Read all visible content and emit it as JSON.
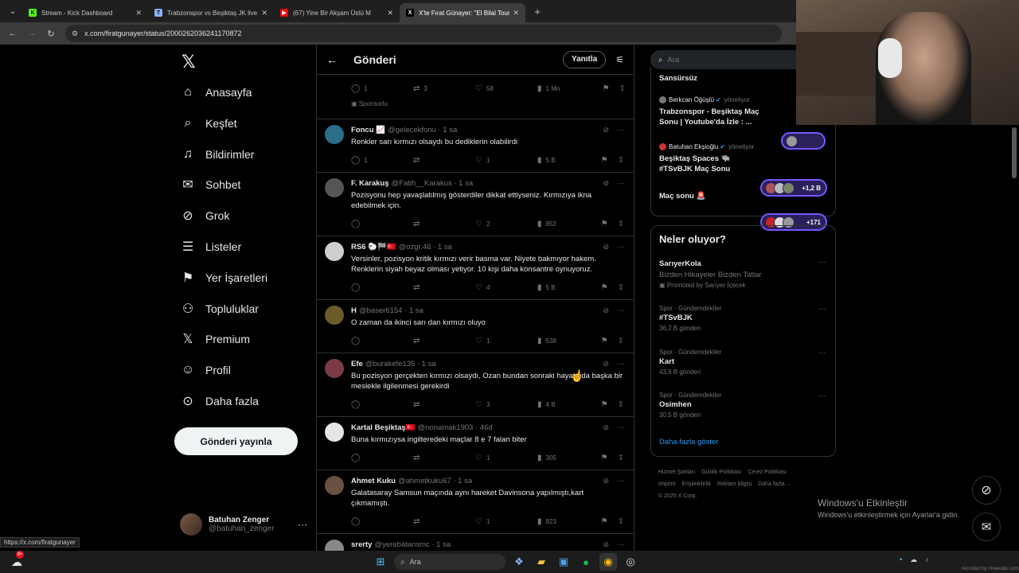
{
  "browser": {
    "tabs": [
      {
        "label": "Stream - Kick Dashboard",
        "fav": "K",
        "color": "#53fc18"
      },
      {
        "label": "Trabzonspor vs Beşiktaş JK live",
        "fav": "T",
        "color": "#8ab4f8"
      },
      {
        "label": "(67) Yine Bir Akşam Üstü M",
        "fav": "▶",
        "color": "#ff0000"
      },
      {
        "label": "X'te Fırat Günayer: \"El Bilal Tour",
        "fav": "X",
        "color": "#ffffff"
      }
    ],
    "url": "x.com/firatgunayer/status/2000262036241170872"
  },
  "nav": {
    "items": [
      {
        "icon": "home-icon",
        "glyph": "⌂",
        "label": "Anasayfa"
      },
      {
        "icon": "search-icon",
        "glyph": "⌕",
        "label": "Keşfet"
      },
      {
        "icon": "bell-icon",
        "glyph": "♫",
        "label": "Bildirimler"
      },
      {
        "icon": "mail-icon",
        "glyph": "✉",
        "label": "Sohbet"
      },
      {
        "icon": "grok-icon",
        "glyph": "⊘",
        "label": "Grok"
      },
      {
        "icon": "list-icon",
        "glyph": "☰",
        "label": "Listeler"
      },
      {
        "icon": "bookmark-icon",
        "glyph": "⚑",
        "label": "Yer İşaretleri"
      },
      {
        "icon": "community-icon",
        "glyph": "⚇",
        "label": "Topluluklar"
      },
      {
        "icon": "x-premium-icon",
        "glyph": "𝕏",
        "label": "Premium"
      },
      {
        "icon": "profile-icon",
        "glyph": "☺",
        "label": "Profil"
      },
      {
        "icon": "more-circle-icon",
        "glyph": "⊙",
        "label": "Daha fazla"
      }
    ],
    "post_button": "Gönderi yayınla",
    "user": {
      "name": "Batuhan Zenger",
      "handle": "@batuhan_zenger"
    }
  },
  "header": {
    "title": "Gönderi",
    "reply_button": "Yanıtla"
  },
  "top_strip": {
    "replies": "1",
    "reposts": "3",
    "likes": "58",
    "views": "1 Mn",
    "sponsored": "Sponsorlu"
  },
  "posts": [
    {
      "name": "Foncu 📈",
      "handle": "@gelecekfonu · 1 sa",
      "text": "Renkler sarı kırmızı olsaydı bu dediklerin olabilirdi",
      "replies": "1",
      "reposts": "",
      "likes": "1",
      "views": "5 B",
      "avatar": "#2a6f8a"
    },
    {
      "name": "F. Karakuş",
      "handle": "@Fatih__Karakus · 1 sa",
      "text": "Pozisyonu hep yavaşlatılmış gösterdiler dikkat ettiyseniz. Kırmızıya ikna edebilmek için.",
      "replies": "",
      "reposts": "",
      "likes": "2",
      "views": "852",
      "avatar": "#555555"
    },
    {
      "name": "RS6 🐑🏁🇹🇷",
      "handle": "@ozgr.46 · 1 sa",
      "text": "Versinler, pozisyon kritik kırmızı verir basma var. Niyete bakmıyor hakem. Renklerin siyah beyaz olması yetiyor. 10 kişi daha konsantre oynuyoruz.",
      "replies": "",
      "reposts": "",
      "likes": "4",
      "views": "5 B",
      "avatar": "#cfcfcf"
    },
    {
      "name": "H",
      "handle": "@baser6154 · 1 sa",
      "text": "O zaman da ikinci sarı dan kırmızı oluyo",
      "replies": "",
      "reposts": "",
      "likes": "1",
      "views": "538",
      "avatar": "#6b5a2a"
    },
    {
      "name": "Efe",
      "handle": "@burakefe135 · 1 sa",
      "text": "Bu pozisyon gerçekten  kırmızı olsaydı, Ozan bundan sonraki hayatında başka bir meslekle ilgilenmesi gerekirdi",
      "replies": "",
      "reposts": "",
      "likes": "3",
      "views": "4 B",
      "avatar": "#7a3a4a"
    },
    {
      "name": "Kartal Beşiktaş🇹🇷",
      "handle": "@nonamak1903 · 46d",
      "text": "Buna kırmızıysa ingilteredeki maçlar 8 e 7 falan biter",
      "replies": "",
      "reposts": "",
      "likes": "1",
      "views": "305",
      "avatar": "#e6e6e6"
    },
    {
      "name": "Ahmet Kuku",
      "handle": "@ahmetkuku67 · 1 sa",
      "text": "Galatasaray Samsun maçında aynı hareket Davinsona yapılmıştı,kart çıkmamıştı.",
      "replies": "",
      "reposts": "",
      "likes": "1",
      "views": "823",
      "avatar": "#6a5040"
    },
    {
      "name": "srerty",
      "handle": "@yerebatansmc · 1 sa",
      "text": "",
      "replies": "",
      "reposts": "",
      "likes": "",
      "views": "",
      "avatar": "#888888"
    }
  ],
  "right": {
    "search_placeholder": "Ara",
    "spaces": [
      {
        "host": "",
        "role": "",
        "title": "Sansürsüz",
        "count": ""
      },
      {
        "host": "Berkcan Öğüşlü",
        "role": "yönetiyor",
        "title": "Trabzonspor - Beşiktaş Maç Sonu | Youtube'da İzle : ...",
        "count": ""
      },
      {
        "host": "Batuhan Ekşioğlu",
        "role": "yönetiyor",
        "title": "Beşiktaş Spaces 🐃 #TSvBJK Maç Sonu",
        "count": "+1,2 B"
      },
      {
        "host": "",
        "role": "",
        "title": "Maç sonu 🚨",
        "count": "+171"
      }
    ],
    "trends_title": "Neler oluyor?",
    "trends": [
      {
        "cat": "",
        "name": "SarıyerKola",
        "sub": "Bizden Hikayeler Bizden Tatlar",
        "count": "Promoted by Sarıyer İçecek"
      },
      {
        "cat": "Spor · Gündemdekiler",
        "name": "#TSvBJK",
        "sub": "",
        "count": "36,2 B gönderi"
      },
      {
        "cat": "Spor · Gündemdekiler",
        "name": "Kart",
        "sub": "",
        "count": "43,6 B gönderi"
      },
      {
        "cat": "Spor · Gündemdekiler",
        "name": "Osimhen",
        "sub": "",
        "count": "30,5 B gönderi"
      }
    ],
    "show_more": "Daha fazla göster",
    "footer_links": [
      "Hizmet Şartları",
      "Gizlilik Politikası",
      "Çerez Politikası",
      "Imprint",
      "Erişilebilirlik",
      "Reklam bilgisi",
      "Daha fazla ...",
      "© 2025 X Corp."
    ]
  },
  "windows": {
    "activate_title": "Windows'u Etkinleştir",
    "activate_sub": "Windows'u etkinleştirmek için Ayarlar'a gidin.",
    "status_url": "https://x.com/firatgunayer",
    "search": "Ara",
    "badge": "9+",
    "recorded": "recorded by moewalls.com"
  }
}
